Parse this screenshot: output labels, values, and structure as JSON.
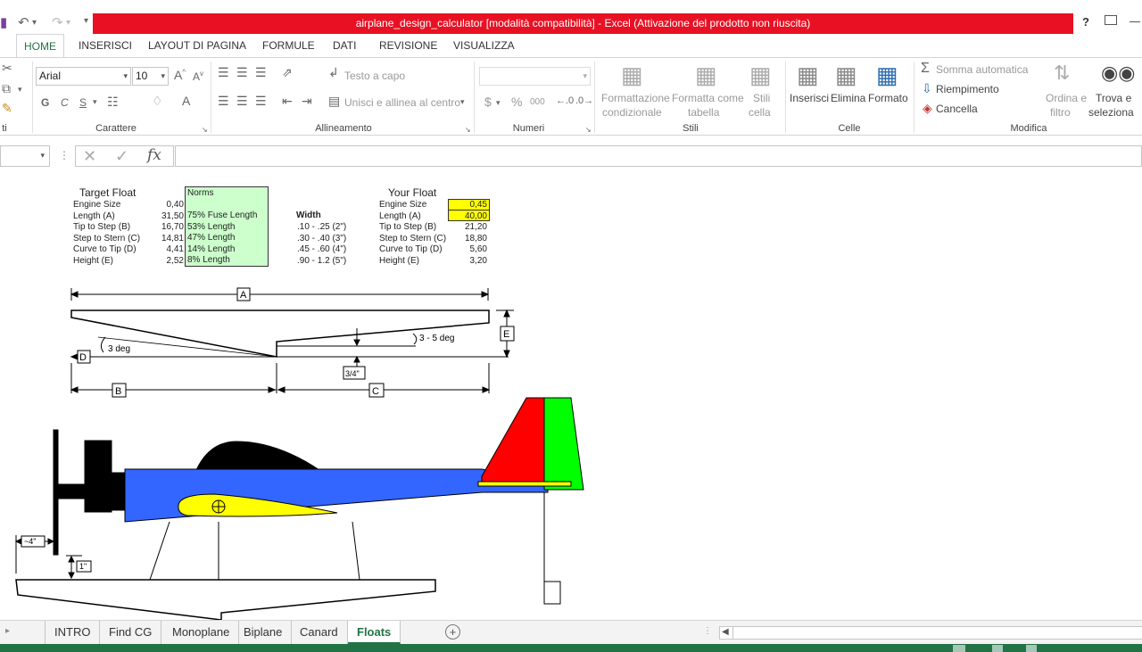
{
  "window": {
    "title": "airplane_design_calculator  [modalità compatibilità] -  Excel (Attivazione del prodotto non riuscita)",
    "help": "?"
  },
  "tabs": [
    "HOME",
    "INSERISCI",
    "LAYOUT DI PAGINA",
    "FORMULE",
    "DATI",
    "REVISIONE",
    "VISUALIZZA"
  ],
  "ribbon": {
    "font_name": "Arial",
    "font_size": "10",
    "bold": "G",
    "italic": "C",
    "underline": "S",
    "wrap_text": "Testo a capo",
    "merge_center": "Unisci e allinea al centro",
    "currency": "$",
    "percent": "%",
    "thousands": "000",
    "cond_format": [
      "Formattazione",
      "condizionale"
    ],
    "format_table": [
      "Formatta come",
      "tabella"
    ],
    "cell_styles": [
      "Stili",
      "cella"
    ],
    "insert": "Inserisci",
    "delete": "Elimina",
    "format": "Formato",
    "autosum": "Somma automatica",
    "fill": "Riempimento",
    "clear": "Cancella",
    "sort": [
      "Ordina e",
      "filtro"
    ],
    "find": [
      "Trova e",
      "seleziona"
    ],
    "groups": {
      "clipboard_cut": "ti",
      "font": "Carattere",
      "alignment": "Allineamento",
      "number": "Numeri",
      "styles": "Stili",
      "cells": "Celle",
      "editing": "Modifica"
    }
  },
  "formula_bar": {
    "fx": "fx",
    "value": ""
  },
  "sheet": {
    "target": {
      "title": "Target Float",
      "rows": [
        {
          "label": "Engine Size",
          "value": "0,40"
        },
        {
          "label": "Length (A)",
          "value": "31,50"
        },
        {
          "label": "Tip to Step (B)",
          "value": "16,70"
        },
        {
          "label": "Step to Stern (C)",
          "value": "14,81"
        },
        {
          "label": "Curve to Tip (D)",
          "value": "4,41"
        },
        {
          "label": "Height (E)",
          "value": "2,52"
        }
      ]
    },
    "norms": {
      "title": "Norms",
      "rows": [
        "75% Fuse Length",
        "53% Length",
        "47% Length",
        "14% Length",
        "8% Length"
      ],
      "bg": "#ccffcc"
    },
    "width": {
      "title": "Width",
      "rows": [
        ".10 - .25 (2\")",
        ".30 - .40 (3\")",
        ".45 - .60 (4\")",
        ".90 - 1.2 (5\")"
      ]
    },
    "your": {
      "title": "Your Float",
      "rows": [
        {
          "label": "Engine Size",
          "value": "0,45",
          "input": true
        },
        {
          "label": "Length (A)",
          "value": "40,00",
          "input": true
        },
        {
          "label": "Tip to Step (B)",
          "value": "21,20"
        },
        {
          "label": "Step to Stern (C)",
          "value": "18,80"
        },
        {
          "label": "Curve to Tip (D)",
          "value": "5,60"
        },
        {
          "label": "Height (E)",
          "value": "3,20"
        }
      ],
      "input_bg": "#ffff00"
    },
    "diagram": {
      "A": "A",
      "B": "B",
      "C": "C",
      "D": "D",
      "E": "E",
      "deg3": "3 deg",
      "deg35": "3 - 5 deg",
      "step": "3/4\"",
      "prop_gap": "~4\"",
      "float_gap": "1\""
    },
    "plane_colors": {
      "fuselage": "#3366ff",
      "wing": "#ffff00",
      "rudder": "#ff0000",
      "fin": "#00ff00",
      "canopy": "#000000"
    }
  },
  "sheet_tabs": [
    "INTRO",
    "Find CG",
    "Monoplane",
    "Biplane",
    "Canard",
    "Floats"
  ],
  "active_sheet": "Floats",
  "accent": "#217346"
}
